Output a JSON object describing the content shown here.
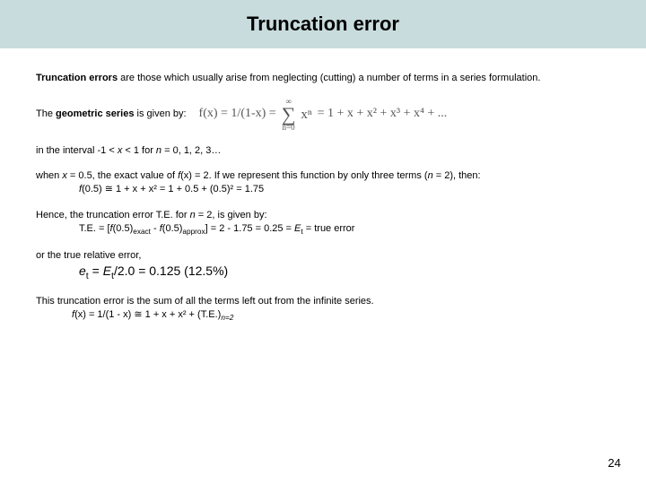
{
  "title": "Truncation error",
  "p1_a": "Truncation errors",
  "p1_b": " are those which usually arise from neglecting (cutting) a number of terms in a series formulation.",
  "p2_a": "The ",
  "p2_b": "geometric series",
  "p2_c": " is given by:",
  "formula_lhs": "f(x) = 1/(1-x) = ",
  "formula_top": "∞",
  "formula_bot": "n=0",
  "formula_xn": "xⁿ",
  "formula_rhs": " = 1 + x + x² + x³ + x⁴ + ...",
  "p3_a": "in the interval -1 < ",
  "p3_b": "x",
  "p3_c": " < 1 for ",
  "p3_d": "n",
  "p3_e": " = 0, 1, 2, 3…",
  "p4_a": "when ",
  "p4_b": "x",
  "p4_c": " = 0.5, the exact value of ",
  "p4_d": "f",
  "p4_e": "(x) = 2.  If we represent this function by only three terms (",
  "p4_f": "n",
  "p4_g": " = 2), then:",
  "p4_eq_a": "f",
  "p4_eq_b": "(0.5) ≅  1 + x + x²  = 1 + 0.5 + (0.5)² = 1.75",
  "p5_a": "Hence, the truncation error T.E. for ",
  "p5_b": "n",
  "p5_c": " = 2, is given by:",
  "p5_eq_a": "T.E. = [",
  "p5_eq_b": "f",
  "p5_eq_c": "(0.5)",
  "p5_eq_d": "exact",
  "p5_eq_e": " - ",
  "p5_eq_f": "f",
  "p5_eq_g": "(0.5)",
  "p5_eq_h": "approx",
  "p5_eq_i": "] = 2 - 1.75 = 0.25 = ",
  "p5_eq_j": "E",
  "p5_eq_k": "t",
  "p5_eq_l": " = true error",
  "p6": "or the true relative error,",
  "p6_eq_a": "e",
  "p6_eq_b": "t",
  "p6_eq_c": " = ",
  "p6_eq_d": "E",
  "p6_eq_e": "t",
  "p6_eq_f": "/2.0 = 0.125 (12.5%)",
  "p7": "This truncation error is the sum of all the terms left out from the infinite series.",
  "p7_eq_a": "f",
  "p7_eq_b": "(x) = 1/(1 - x) ≅ 1 + x + x² + (T.E.)",
  "p7_eq_c": "n=2",
  "page_num": "24"
}
